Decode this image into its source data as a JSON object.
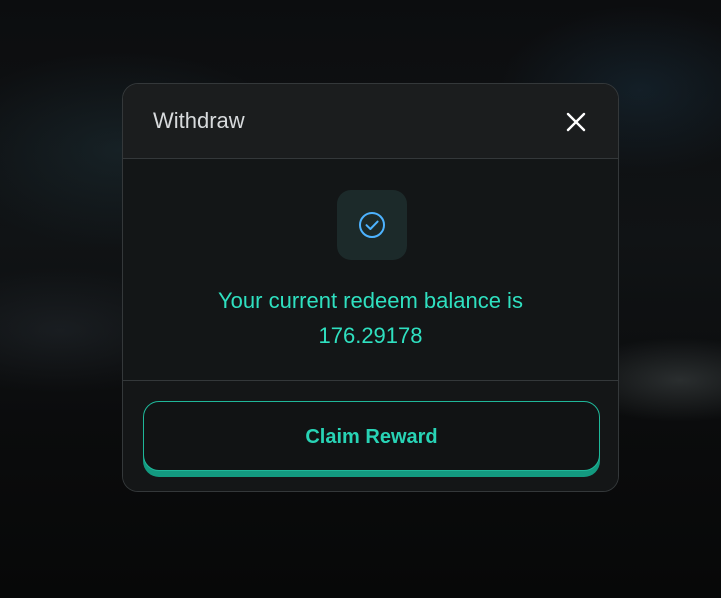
{
  "modal": {
    "title": "Withdraw",
    "close_icon": "close-icon",
    "status_icon": "check-circle-icon",
    "balance_line1": "Your current redeem balance is",
    "balance_value": "176.29178",
    "claim_label": "Claim Reward"
  },
  "colors": {
    "accent": "#2fe0c0",
    "button_border": "#1fb799",
    "icon_blue": "#4db3ff"
  }
}
